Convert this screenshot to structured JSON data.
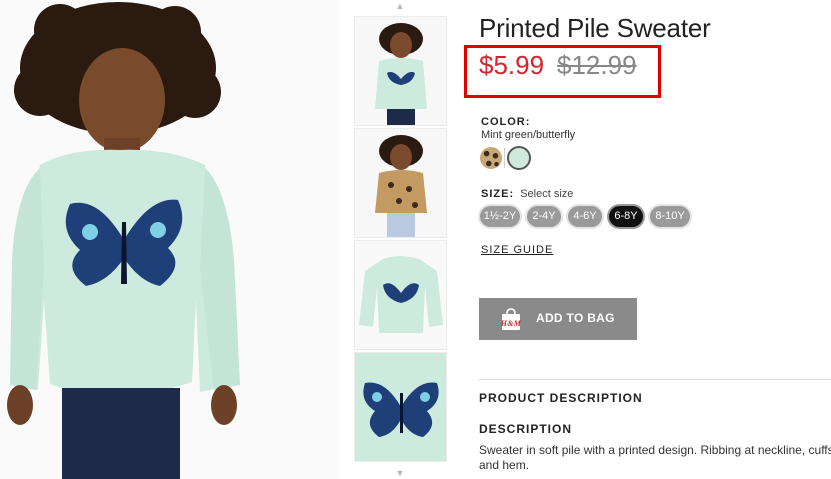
{
  "product": {
    "title": "Printed Pile Sweater",
    "sale_price": "$5.99",
    "original_price": "$12.99"
  },
  "color": {
    "label": "COLOR:",
    "value": "Mint green/butterfly",
    "swatches": [
      "leopard",
      "mint green"
    ]
  },
  "size": {
    "label": "SIZE:",
    "hint": "Select size",
    "options": [
      "1½-2Y",
      "2-4Y",
      "4-6Y",
      "6-8Y",
      "8-10Y"
    ],
    "selected": "6-8Y"
  },
  "size_guide": "SIZE GUIDE",
  "add_to_bag": {
    "label": "ADD TO BAG",
    "logo_text": "H&M"
  },
  "description": {
    "section_heading": "PRODUCT DESCRIPTION",
    "heading": "DESCRIPTION",
    "text": "Sweater in soft pile with a printed design. Ribbing at neckline, cuffs, and hem."
  },
  "colors": {
    "sale_red": "#d6232e",
    "highlight_box": "#e00000",
    "button_gray": "#8a8a8a",
    "mint": "#cfe9dc"
  }
}
